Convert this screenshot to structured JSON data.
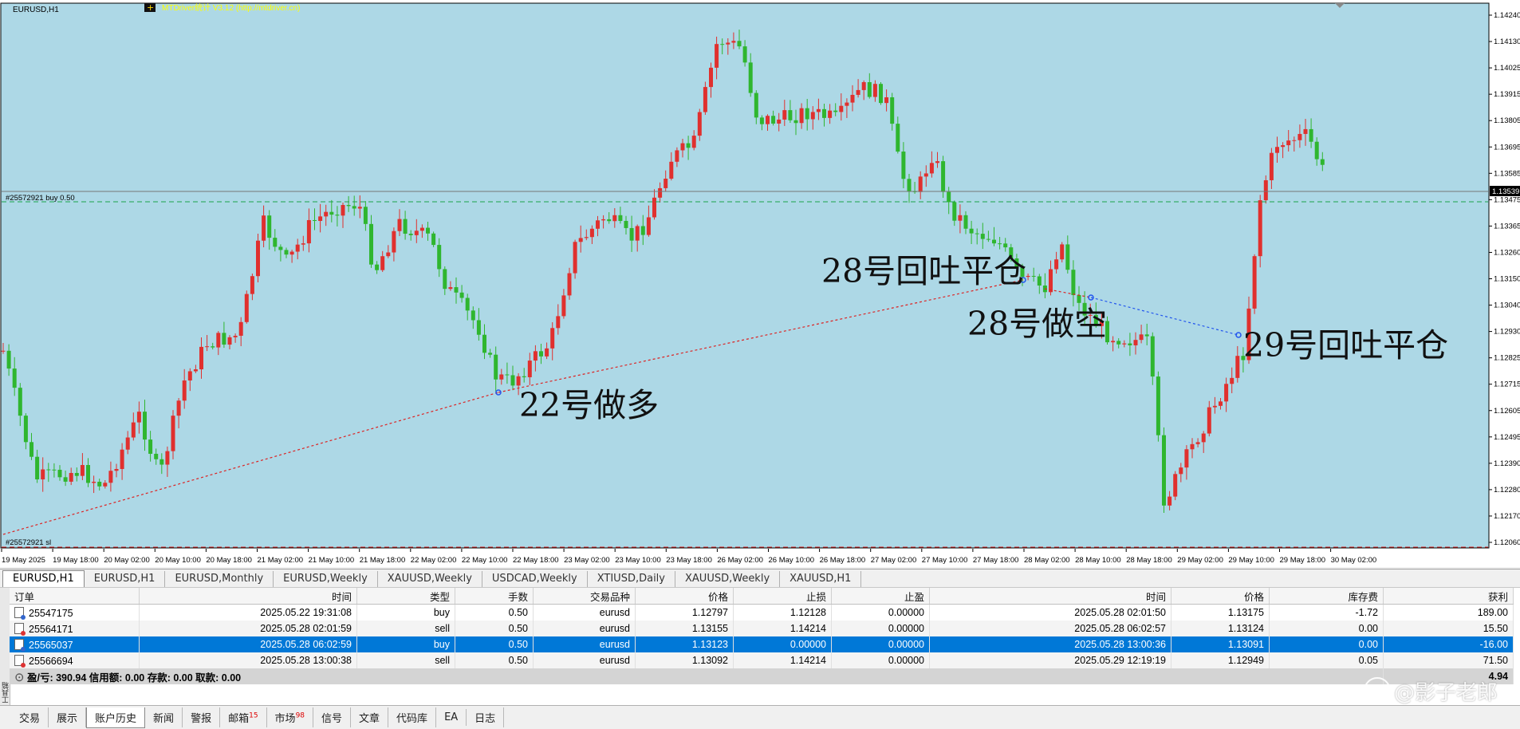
{
  "chart": {
    "symbol_label": "EURUSD,H1",
    "indicator_label": "MTDriver统计 V3.12 (http://mtdriver.cn)",
    "bg_color": "#add8e6",
    "up_color": "#e0302e",
    "down_color": "#2fb62f",
    "order_line_label": "#25572921 buy 0.50",
    "sl_line_label": "#25572921 sl",
    "current_price": "1.13539",
    "y_labels": [
      "1.14240",
      "1.14130",
      "1.14025",
      "1.13915",
      "1.13805",
      "1.13695",
      "1.13585",
      "1.13475",
      "1.13365",
      "1.13260",
      "1.13150",
      "1.13040",
      "1.12930",
      "1.12825",
      "1.12715",
      "1.12605",
      "1.12495",
      "1.12390",
      "1.12280",
      "1.12170",
      "1.12060"
    ],
    "x_labels": [
      "19 May 2025",
      "19 May 18:00",
      "20 May 02:00",
      "20 May 10:00",
      "20 May 18:00",
      "21 May 02:00",
      "21 May 10:00",
      "21 May 18:00",
      "22 May 02:00",
      "22 May 10:00",
      "22 May 18:00",
      "23 May 02:00",
      "23 May 10:00",
      "23 May 18:00",
      "26 May 02:00",
      "26 May 10:00",
      "26 May 18:00",
      "27 May 02:00",
      "27 May 10:00",
      "27 May 18:00",
      "28 May 02:00",
      "28 May 10:00",
      "28 May 18:00",
      "29 May 02:00",
      "29 May 10:00",
      "29 May 18:00",
      "30 May 02:00"
    ],
    "annotations": [
      "22号做多",
      "28号回吐平仓",
      "28号做空",
      "29号回吐平仓"
    ]
  },
  "chart_tabs": [
    "EURUSD,H1",
    "EURUSD,H1",
    "EURUSD,Monthly",
    "EURUSD,Weekly",
    "XAUUSD,Weekly",
    "USDCAD,Weekly",
    "XTIUSD,Daily",
    "XAUUSD,Weekly",
    "XAUUSD,H1"
  ],
  "terminal": {
    "side_label": "工具箱",
    "headers": [
      "订单",
      "时间",
      "类型",
      "手数",
      "交易品种",
      "价格",
      "止损",
      "止盈",
      "时间",
      "价格",
      "库存费",
      "获利"
    ],
    "rows": [
      [
        "25547175",
        "2025.05.22 19:31:08",
        "buy",
        "0.50",
        "eurusd",
        "1.12797",
        "1.12128",
        "0.00000",
        "2025.05.28 02:01:50",
        "1.13175",
        "-1.72",
        "189.00"
      ],
      [
        "25564171",
        "2025.05.28 02:01:59",
        "sell",
        "0.50",
        "eurusd",
        "1.13155",
        "1.14214",
        "0.00000",
        "2025.05.28 06:02:57",
        "1.13124",
        "0.00",
        "15.50"
      ],
      [
        "25565037",
        "2025.05.28 06:02:59",
        "buy",
        "0.50",
        "eurusd",
        "1.13123",
        "0.00000",
        "0.00000",
        "2025.05.28 13:00:36",
        "1.13091",
        "0.00",
        "-16.00"
      ],
      [
        "25566694",
        "2025.05.28 13:00:38",
        "sell",
        "0.50",
        "eurusd",
        "1.13092",
        "1.14214",
        "0.00000",
        "2025.05.29 12:19:19",
        "1.12949",
        "0.05",
        "71.50"
      ]
    ],
    "summary": "盈/亏: 390.94  信用额: 0.00  存款: 0.00  取款: 0.00",
    "summary_total": "4.94"
  },
  "bottom_tabs": [
    {
      "label": "交易",
      "badge": ""
    },
    {
      "label": "展示",
      "badge": ""
    },
    {
      "label": "账户历史",
      "badge": ""
    },
    {
      "label": "新闻",
      "badge": ""
    },
    {
      "label": "警报",
      "badge": ""
    },
    {
      "label": "邮箱",
      "badge": "15"
    },
    {
      "label": "市场",
      "badge": "98"
    },
    {
      "label": "信号",
      "badge": ""
    },
    {
      "label": "文章",
      "badge": ""
    },
    {
      "label": "代码库",
      "badge": ""
    },
    {
      "label": "EA",
      "badge": ""
    },
    {
      "label": "日志",
      "badge": ""
    }
  ],
  "watermark": "@影子老郎"
}
